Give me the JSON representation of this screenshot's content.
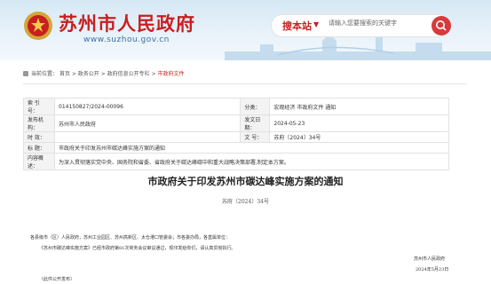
{
  "header": {
    "site_title": "苏州市人民政府",
    "site_url": "www.suzhou.gov.cn",
    "search_scope": "搜本站",
    "search_placeholder": "请输入您要搜索的关键字"
  },
  "breadcrumb": [
    "当前位置：",
    "首页",
    "政务公开",
    "政府信息公开专栏",
    "市政府文件"
  ],
  "meta": {
    "index_label": "索 引 号：",
    "index_value": "014150827/2024-00096",
    "category_label": "分类：",
    "category_value": "宏观经济 市政府文件 通知",
    "org_label": "发布机构：",
    "org_value": "苏州市人民政府",
    "date_label": "发文日期：",
    "date_value": "2024-05-23",
    "time_label": "时 效：",
    "time_value": "",
    "docno_label": "文 号：",
    "docno_value": "苏府〔2024〕34号",
    "title_label": "标 题：",
    "title_value": "市政府关于印发苏州市碳达峰实施方案的通知",
    "summary_label": "内容概述：",
    "summary_value": "为深入贯彻落实党中央、国务院和省委、省政府关于碳达峰碳中和重大战略决策部署,制定本方案。"
  },
  "document": {
    "title": "市政府关于印发苏州市碳达峰实施方案的通知",
    "number": "苏府〔2024〕34号",
    "recipients": "各县级市（区）人民政府，苏州工业园区、苏州高新区、太仓港口管委会；市各委办局，各直属单位：",
    "body": "《苏州市碳达峰实施方案》已经市政府第81次常务会议审议通过，现印发给你们，请认真贯彻执行。",
    "sign_org": "苏州市人民政府",
    "sign_date": "2024年5月23日",
    "note": "（此件公开发布）"
  }
}
